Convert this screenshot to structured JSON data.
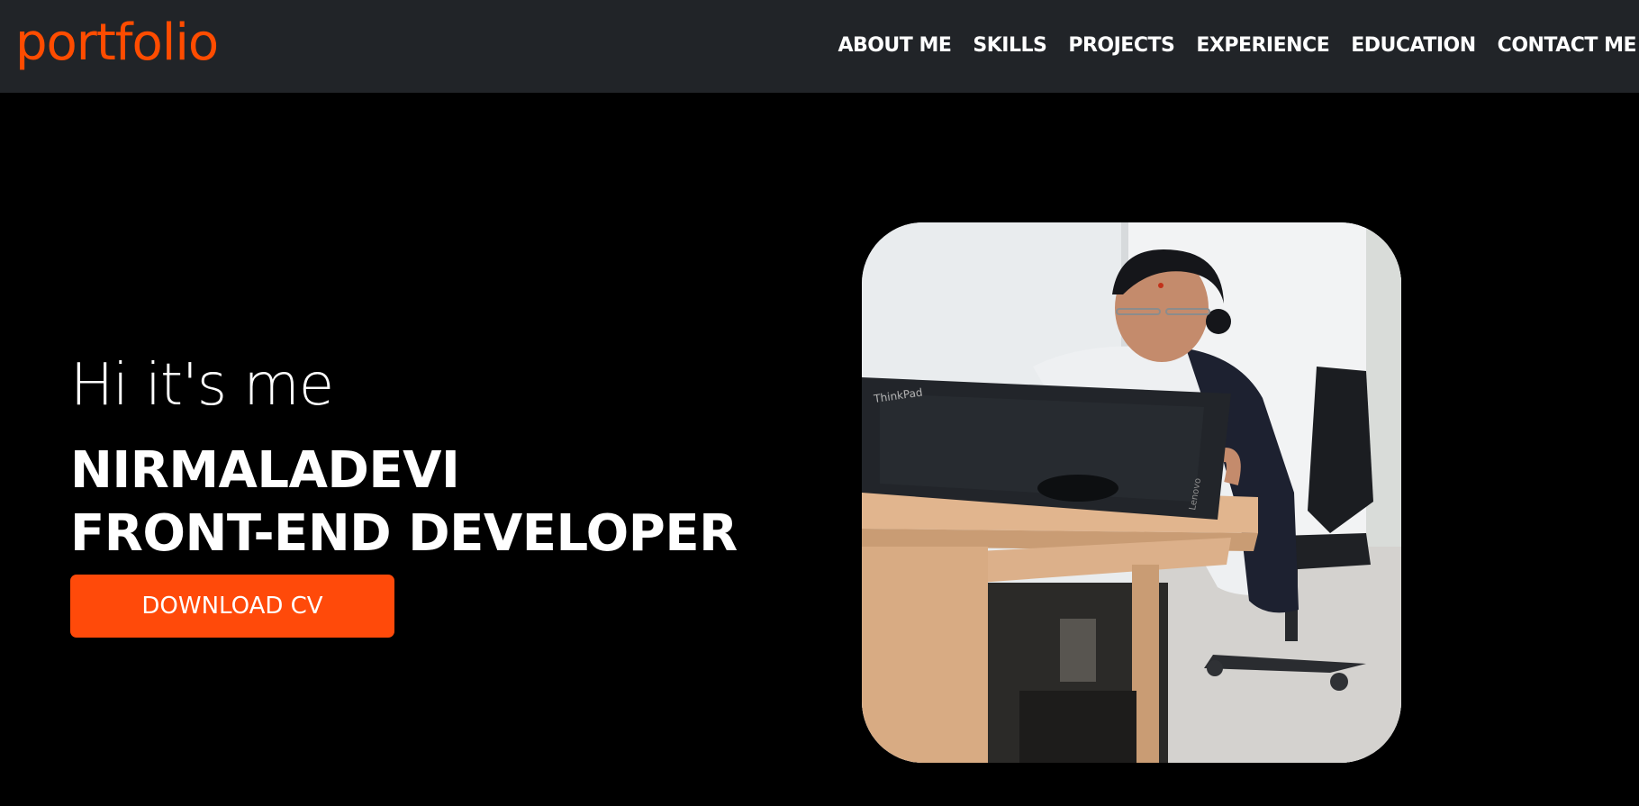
{
  "header": {
    "logo": "portfolio",
    "nav_items": [
      {
        "label": "ABOUT ME"
      },
      {
        "label": "SKILLS"
      },
      {
        "label": "PROJECTS"
      },
      {
        "label": "EXPERIENCE"
      },
      {
        "label": "EDUCATION"
      },
      {
        "label": "CONTACT ME"
      }
    ]
  },
  "hero": {
    "greeting": "Hi it's me",
    "name": "NIRMALADEVI",
    "role": "FRONT-END DEVELOPER",
    "cta_label": "DOWNLOAD CV"
  },
  "photo": {
    "laptop_brand": "ThinkPad",
    "laptop_logo": "Lenovo"
  },
  "colors": {
    "accent": "#ff4c00",
    "navbar_bg": "#212428",
    "page_bg": "#000000",
    "text": "#ffffff"
  }
}
